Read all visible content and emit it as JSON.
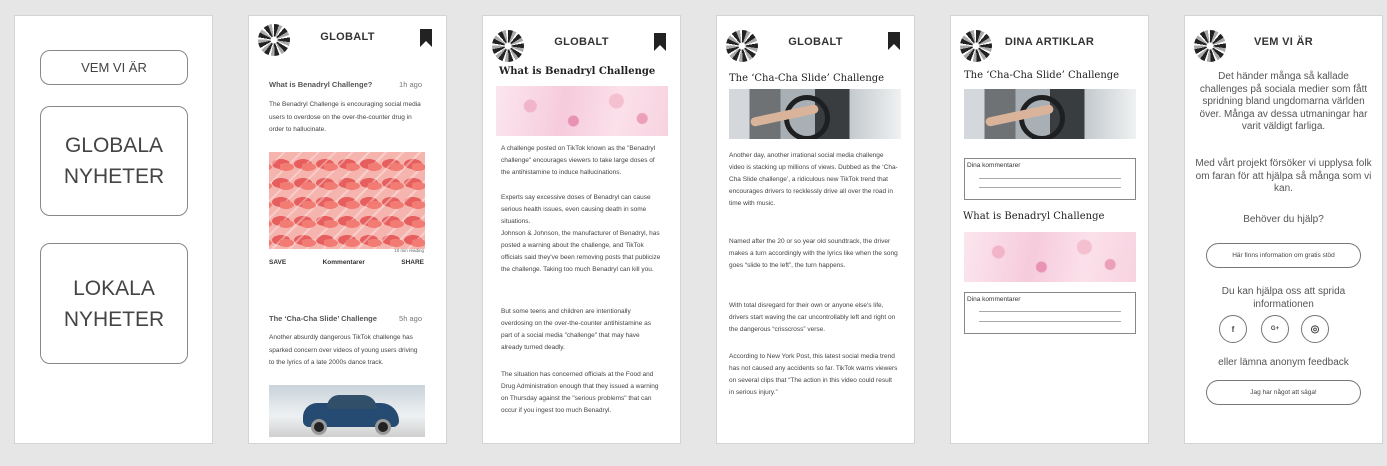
{
  "screen1": {
    "about_label": "VEM VI ÄR",
    "global_news_label": "GLOBALA\nNYHETER",
    "local_news_label": "LOKALA\nNYHETER"
  },
  "screen2": {
    "header_title": "GLOBALT",
    "items": [
      {
        "title": "What is Benadryl Challenge?",
        "time": "1h ago",
        "summary": "The Benadryl Challenge is encouraging social media users to overdose on the over-the-counter drug in order to hallucinate.",
        "image_caption": "10 min reading",
        "save": "SAVE",
        "comments": "Kommentarer",
        "share": "SHARE"
      },
      {
        "title": "The ‘Cha-Cha Slide’ Challenge",
        "time": "5h ago",
        "summary": "Another absurdly dangerous TikTok challenge has sparked concern over videos of young users driving to the lyrics of a late 2000s dance track."
      }
    ]
  },
  "screen3": {
    "header_title": "GLOBALT",
    "article_title": "What is Benadryl Challenge",
    "para1": "A challenge posted on TikTok known as the \"Benadryl challenge\" encourages viewers to take large doses of the antihistamine to induce hallucinations.",
    "para2": "Experts say excessive doses of Benadryl can cause serious health issues, even causing death in some situations.",
    "para3": "Johnson & Johnson, the manufacturer of Benadryl, has posted a warning about the challenge, and TikTok officials said they've been removing posts that publicize the challenge. Taking too much Benadryl can kill you.",
    "para4": "But some teens and children are intentionally overdosing on the over-the-counter antihistamine as part of a social media \"challenge\" that may have already turned deadly.",
    "para5": "The situation has concerned officials at the Food and Drug Administration enough that they issued a warning on Thursday against the \"serious problems\" that can occur if you ingest too much Benadryl."
  },
  "screen4": {
    "header_title": "GLOBALT",
    "article_title": "The ‘Cha-Cha Slide’ Challenge",
    "para1": "Another day, another irrational social media challenge video is stacking up millions of views. Dubbed as the ‘Cha-Cha Slide challenge’, a ridiculous new TikTok trend that encourages drivers to recklessly drive all over the road in time with music.",
    "para2": "Named after the 20 or so year old soundtrack, the driver makes a turn accordingly with the lyrics like when the song goes “slide to the left”, the turn happens.",
    "para3": "With total disregard for their own or anyone else's life, drivers start waving the car uncontrollably left and right on the dangerous “crisscross” verse.",
    "para4": "According to New York Post, this latest social media trend has not caused any accidents so far. TikTok warns viewers on several clips that “The action in this video could result in serious injury.”"
  },
  "screen5": {
    "header_title": "DINA ARTIKLAR",
    "items": [
      {
        "title": "The ‘Cha-Cha Slide’ Challenge",
        "comments_label": "Dina kommentarer"
      },
      {
        "title": "What is Benadryl Challenge",
        "comments_label": "Dina kommentarer"
      }
    ]
  },
  "screen6": {
    "header_title": "VEM VI ÄR",
    "intro": "Det händer många så kallade challenges på sociala medier som fått spridning bland ungdomarna världen över. Många av dessa utmaningar har varit väldigt farliga.",
    "project": "Med vårt projekt försöker vi upplysa folk om faran för att hjälpa så många som vi kan.",
    "help_question": "Behöver du hjälp?",
    "help_button": "Här finns information om gratis stöd",
    "spread": "Du kan hjälpa oss att sprida informationen",
    "social": {
      "facebook": "f",
      "googleplus": "G+",
      "instagram": "◎"
    },
    "feedback_text": "eller lämna anonym feedback",
    "feedback_button": "Jag har något att säga!"
  },
  "icons": [
    "logo-avatar-icon",
    "bookmark-icon",
    "facebook-icon",
    "google-plus-icon",
    "instagram-icon"
  ]
}
